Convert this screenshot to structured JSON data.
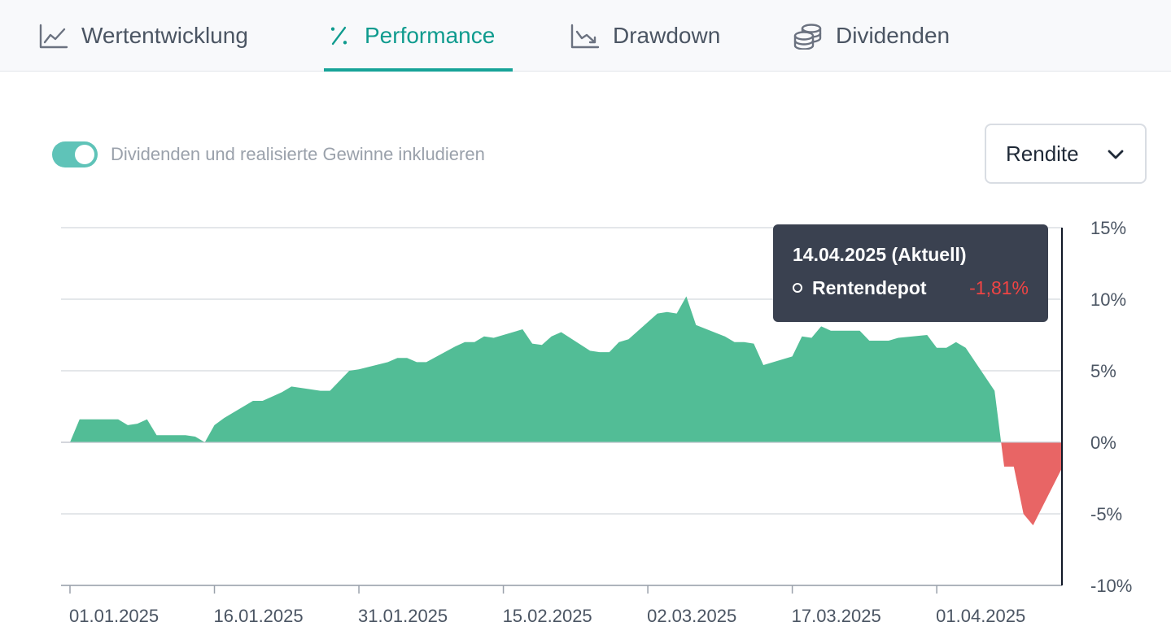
{
  "tabs": [
    {
      "label": "Wertentwicklung",
      "icon": "line-chart-icon"
    },
    {
      "label": "Performance",
      "icon": "percent-icon"
    },
    {
      "label": "Drawdown",
      "icon": "trending-down-chart-icon"
    },
    {
      "label": "Dividenden",
      "icon": "coins-icon"
    }
  ],
  "active_tab": "Performance",
  "toggle": {
    "label": "Dividenden und realisierte Gewinne inkludieren",
    "checked": true
  },
  "metric_select": {
    "value": "Rendite"
  },
  "tooltip": {
    "title": "14.04.2025 (Aktuell)",
    "series": "Rentendepot",
    "value": "-1,81%"
  },
  "colors": {
    "accent": "#17a398",
    "positive": "#52bd96",
    "negative": "#e86565",
    "tooltip_bg": "#3a4150"
  },
  "chart_data": {
    "type": "area",
    "ylim": [
      -10,
      15
    ],
    "yticks": [
      15,
      10,
      5,
      0,
      -5,
      -10
    ],
    "ytick_labels": [
      "15%",
      "10%",
      "5%",
      "0%",
      "-5%",
      "-10%"
    ],
    "xtick_labels": [
      "01.01.2025",
      "16.01.2025",
      "31.01.2025",
      "15.02.2025",
      "02.03.2025",
      "17.03.2025",
      "01.04.2025"
    ],
    "grid": true,
    "series": [
      {
        "name": "Rentendepot",
        "x": [
          "01.01.2025",
          "02.01.2025",
          "03.01.2025",
          "06.01.2025",
          "07.01.2025",
          "08.01.2025",
          "09.01.2025",
          "10.01.2025",
          "13.01.2025",
          "14.01.2025",
          "15.01.2025",
          "16.01.2025",
          "17.01.2025",
          "20.01.2025",
          "21.01.2025",
          "22.01.2025",
          "23.01.2025",
          "24.01.2025",
          "27.01.2025",
          "28.01.2025",
          "29.01.2025",
          "30.01.2025",
          "31.01.2025",
          "03.02.2025",
          "04.02.2025",
          "05.02.2025",
          "06.02.2025",
          "07.02.2025",
          "10.02.2025",
          "11.02.2025",
          "12.02.2025",
          "13.02.2025",
          "14.02.2025",
          "17.02.2025",
          "18.02.2025",
          "19.02.2025",
          "20.02.2025",
          "21.02.2025",
          "24.02.2025",
          "25.02.2025",
          "26.02.2025",
          "27.02.2025",
          "28.02.2025",
          "03.03.2025",
          "04.03.2025",
          "05.03.2025",
          "06.03.2025",
          "07.03.2025",
          "10.03.2025",
          "11.03.2025",
          "12.03.2025",
          "13.03.2025",
          "14.03.2025",
          "17.03.2025",
          "18.03.2025",
          "19.03.2025",
          "20.03.2025",
          "21.03.2025",
          "24.03.2025",
          "25.03.2025",
          "26.03.2025",
          "27.03.2025",
          "28.03.2025",
          "31.03.2025",
          "01.04.2025",
          "02.04.2025",
          "03.04.2025",
          "04.04.2025",
          "07.04.2025",
          "08.04.2025",
          "09.04.2025",
          "10.04.2025",
          "11.04.2025",
          "14.04.2025"
        ],
        "values": [
          0.0,
          1.6,
          1.6,
          1.6,
          1.2,
          1.3,
          1.6,
          0.5,
          0.5,
          0.4,
          0.0,
          1.2,
          1.7,
          2.9,
          2.9,
          3.2,
          3.5,
          3.9,
          3.6,
          3.6,
          4.3,
          5.0,
          5.1,
          5.6,
          5.9,
          5.9,
          5.6,
          5.6,
          6.7,
          7.0,
          7.0,
          7.4,
          7.3,
          7.9,
          6.9,
          6.8,
          7.4,
          7.7,
          6.4,
          6.3,
          6.3,
          7.0,
          7.2,
          9.0,
          9.1,
          9.0,
          10.2,
          8.2,
          7.4,
          7.0,
          7.0,
          6.9,
          5.4,
          6.0,
          7.4,
          7.3,
          8.1,
          7.8,
          7.8,
          7.1,
          7.1,
          7.1,
          7.3,
          7.5,
          6.6,
          6.6,
          7.0,
          6.6,
          3.6,
          -1.7,
          -1.7,
          -5.0,
          -5.8,
          -1.8
        ]
      }
    ]
  }
}
